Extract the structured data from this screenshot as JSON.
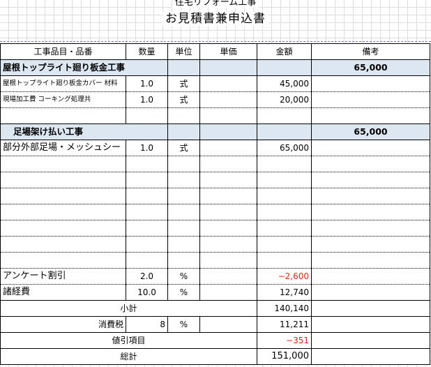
{
  "header": {
    "subtitle": "住宅リフォーム工事",
    "title": "お見積書兼申込書"
  },
  "columns": [
    "工事品目・品番",
    "数量",
    "単位",
    "単価",
    "金額",
    "備考"
  ],
  "groups": [
    {
      "title": "屋根トップライト廻り板金工事",
      "total": "65,000",
      "items": [
        {
          "name": "屋根トップライト廻り板金カバー 材料",
          "qty": "1.0",
          "unit": "式",
          "price": "",
          "amount": "45,000",
          "note": ""
        },
        {
          "name": "現場加工費 コーキング処理共",
          "qty": "1.0",
          "unit": "式",
          "price": "",
          "amount": "20,000",
          "note": ""
        }
      ]
    },
    {
      "title": "足場架け払い工事",
      "total": "65,000",
      "items": [
        {
          "name": "部分外部足場・メッシュシー",
          "qty": "1.0",
          "unit": "式",
          "price": "",
          "amount": "65,000",
          "note": ""
        }
      ]
    }
  ],
  "adjustments": [
    {
      "name": "アンケート割引",
      "qty": "2.0",
      "unit": "%",
      "amount": "−2,600",
      "negative": true
    },
    {
      "name": "諸経費",
      "qty": "10.0",
      "unit": "%",
      "amount": "12,740",
      "negative": false
    }
  ],
  "summary": {
    "subtotal_label": "小計",
    "subtotal": "140,140",
    "tax_label": "消費税",
    "tax_rate": "8",
    "tax_unit": "%",
    "tax": "11,211",
    "discount_label": "値引項目",
    "discount": "−351",
    "total_label": "総計",
    "total": "151,000"
  },
  "colors": {
    "group_fill": "#dde7f2",
    "negative": "#e0241b"
  }
}
